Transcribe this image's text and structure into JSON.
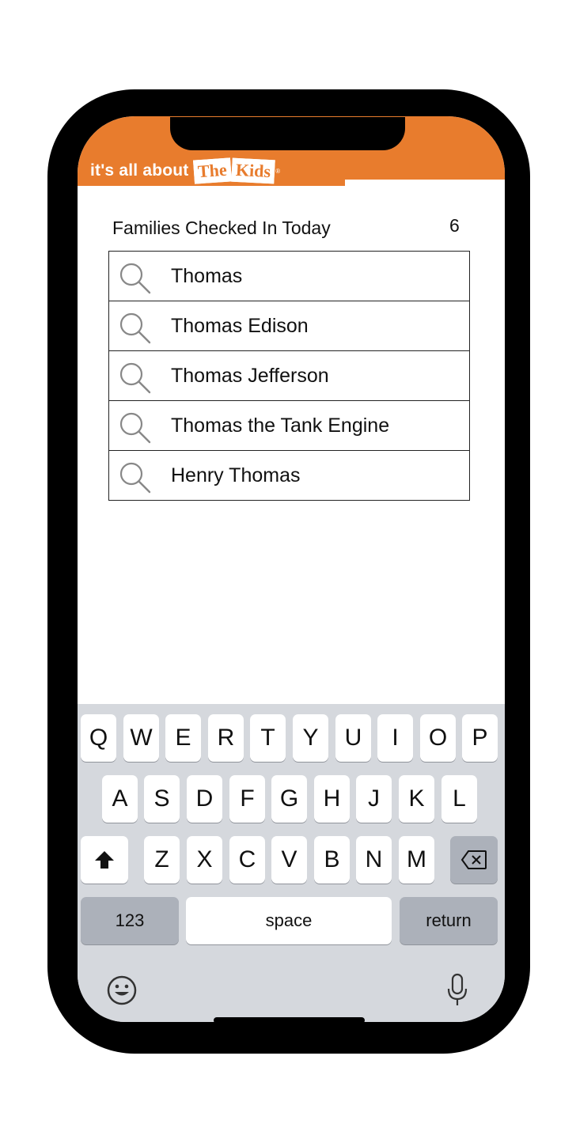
{
  "header": {
    "logo_text": "it's all about",
    "logo_word1": "The",
    "logo_word2": "Kids",
    "logo_reg": "®",
    "color": "#e87c2d"
  },
  "families": {
    "label": "Families Checked In Today",
    "count": "6"
  },
  "results": [
    {
      "name": "Thomas",
      "icon": "search-icon"
    },
    {
      "name": "Thomas Edison",
      "icon": "search-icon"
    },
    {
      "name": "Thomas Jefferson",
      "icon": "search-icon"
    },
    {
      "name": "Thomas the Tank Engine",
      "icon": "search-icon"
    },
    {
      "name": "Henry Thomas",
      "icon": "search-icon"
    }
  ],
  "keyboard": {
    "row1": [
      "Q",
      "W",
      "E",
      "R",
      "T",
      "Y",
      "U",
      "I",
      "O",
      "P"
    ],
    "row2": [
      "A",
      "S",
      "D",
      "F",
      "G",
      "H",
      "J",
      "K",
      "L"
    ],
    "row3": [
      "Z",
      "X",
      "C",
      "V",
      "B",
      "N",
      "M"
    ],
    "numbers_label": "123",
    "space_label": "space",
    "return_label": "return",
    "shift_icon": "shift-icon",
    "delete_icon": "backspace-icon",
    "emoji_icon": "emoji-icon",
    "mic_icon": "microphone-icon"
  }
}
